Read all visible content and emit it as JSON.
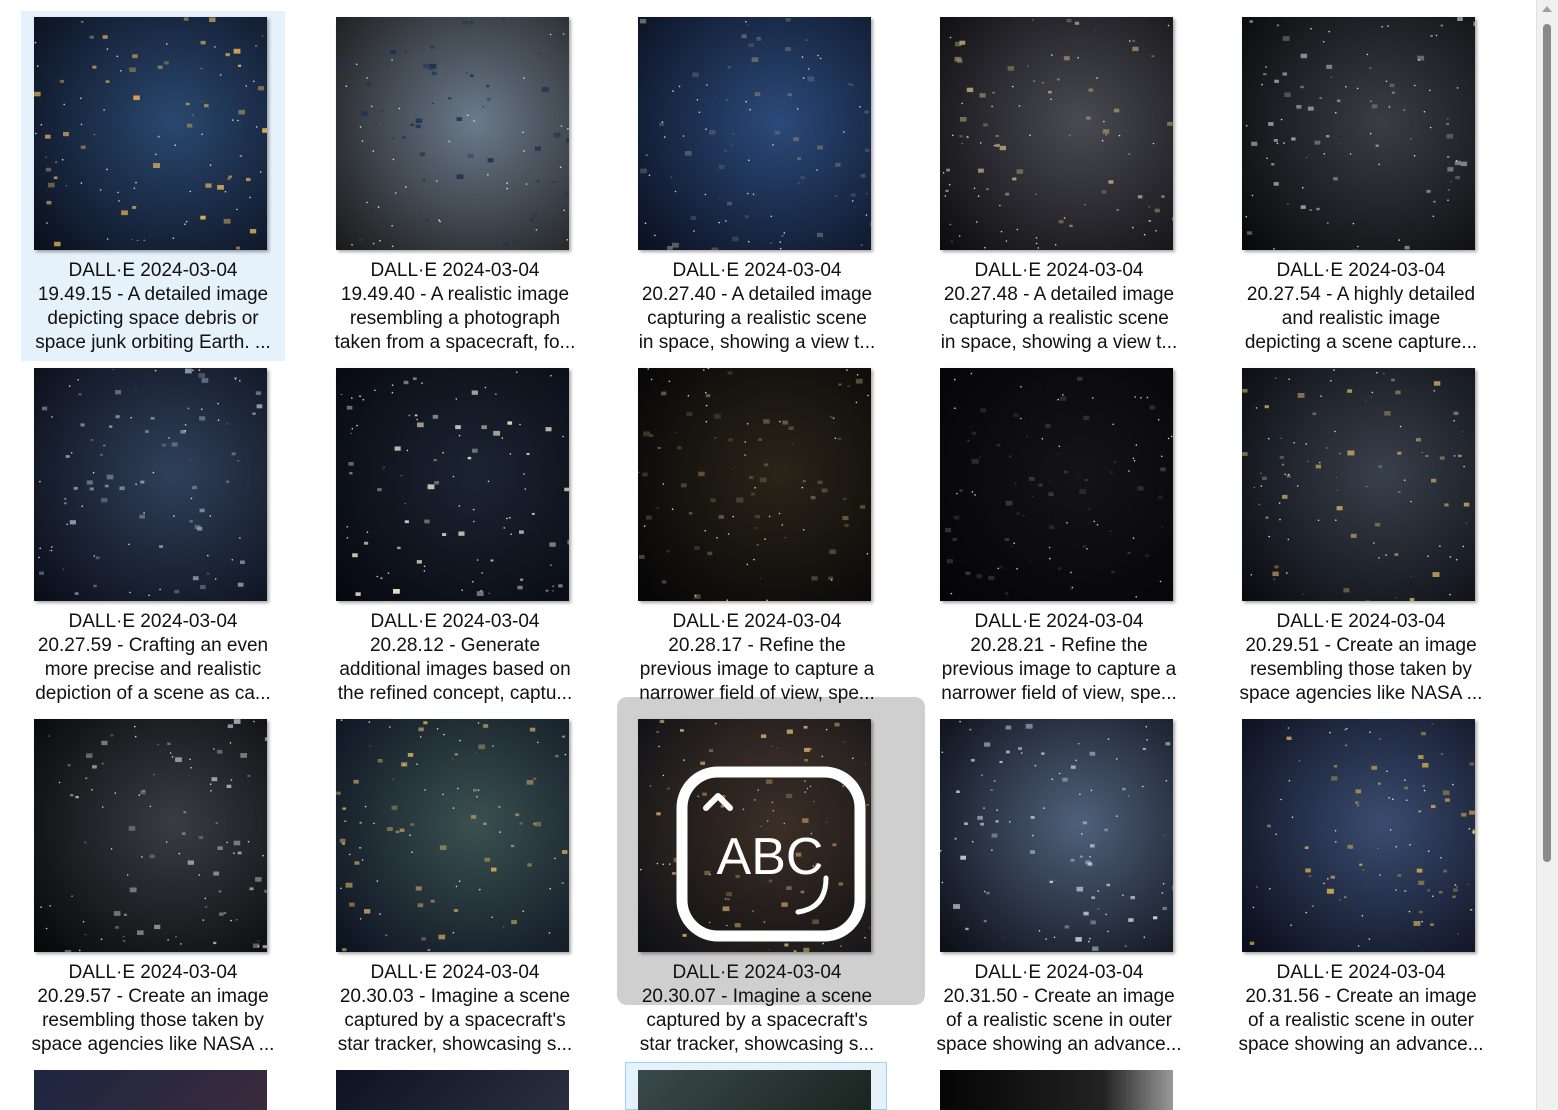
{
  "items": [
    {
      "line1": "DALL·E 2024-03-04",
      "line2": "19.49.15 - A detailed image",
      "line3": "depicting space debris or",
      "line4": "space junk orbiting Earth. ..."
    },
    {
      "line1": "DALL·E 2024-03-04",
      "line2": "19.49.40 - A realistic image",
      "line3": "resembling a photograph",
      "line4": "taken from a spacecraft, fo..."
    },
    {
      "line1": "DALL·E 2024-03-04",
      "line2": "20.27.40 - A detailed image",
      "line3": "capturing a realistic scene",
      "line4": "in space, showing a view t..."
    },
    {
      "line1": "DALL·E 2024-03-04",
      "line2": "20.27.48 - A detailed image",
      "line3": "capturing a realistic scene",
      "line4": "in space, showing a view t..."
    },
    {
      "line1": "DALL·E 2024-03-04",
      "line2": "20.27.54 - A highly detailed",
      "line3": "and realistic image",
      "line4": "depicting a scene capture..."
    },
    {
      "line1": "DALL·E 2024-03-04",
      "line2": "20.27.59 - Crafting an even",
      "line3": "more precise and realistic",
      "line4": "depiction of a scene as ca..."
    },
    {
      "line1": "DALL·E 2024-03-04",
      "line2": "20.28.12 - Generate",
      "line3": "additional images based on",
      "line4": "the refined concept, captu..."
    },
    {
      "line1": "DALL·E 2024-03-04",
      "line2": "20.28.17 - Refine the",
      "line3": "previous image to capture a",
      "line4": "narrower field of view, spe..."
    },
    {
      "line1": "DALL·E 2024-03-04",
      "line2": "20.28.21 - Refine the",
      "line3": "previous image to capture a",
      "line4": "narrower field of view, spe..."
    },
    {
      "line1": "DALL·E 2024-03-04",
      "line2": "20.29.51 - Create an image",
      "line3": "resembling those taken by",
      "line4": "space agencies like NASA ..."
    },
    {
      "line1": "DALL·E 2024-03-04",
      "line2": "20.29.57 - Create an image",
      "line3": "resembling those taken by",
      "line4": "space agencies like NASA ..."
    },
    {
      "line1": "DALL·E 2024-03-04",
      "line2": "20.30.03 - Imagine a scene",
      "line3": "captured by a spacecraft's",
      "line4": "star tracker, showcasing s..."
    },
    {
      "line1": "DALL·E 2024-03-04",
      "line2": "20.30.07 - Imagine a scene",
      "line3": "captured by a spacecraft's",
      "line4": "star tracker, showcasing s..."
    },
    {
      "line1": "DALL·E 2024-03-04",
      "line2": "20.31.50 - Create an image",
      "line3": "of a realistic scene in outer",
      "line4": "space showing an advance..."
    },
    {
      "line1": "DALL·E 2024-03-04",
      "line2": "20.31.56 - Create an image",
      "line3": "of a realistic scene in outer",
      "line4": "space showing an advance..."
    }
  ],
  "ime_overlay": {
    "label": "ABC",
    "icon": "ime-abc-icon"
  },
  "colors": {
    "selection": "#e5f1fb",
    "hover": "#cfcfcf",
    "scroll_thumb": "#8a8a8a"
  }
}
